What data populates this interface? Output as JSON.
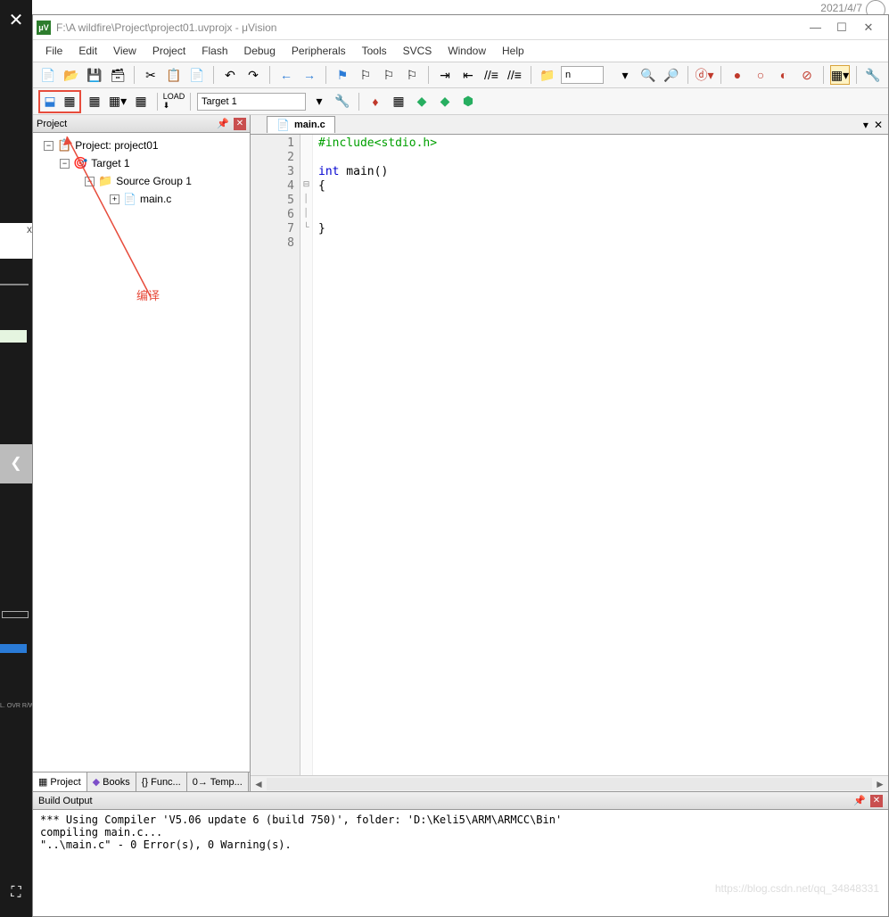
{
  "date": "2021/4/7",
  "window": {
    "title": "F:\\A wildfire\\Project\\project01.uvprojx - μVision",
    "appicon_text": "μV"
  },
  "menu": [
    "File",
    "Edit",
    "View",
    "Project",
    "Flash",
    "Debug",
    "Peripherals",
    "Tools",
    "SVCS",
    "Window",
    "Help"
  ],
  "toolbar1": {
    "search_value": "n"
  },
  "toolbar2": {
    "target": "Target 1"
  },
  "project_panel": {
    "title": "Project",
    "root": "Project: project01",
    "target": "Target 1",
    "group": "Source Group 1",
    "file": "main.c",
    "tabs": {
      "project": "Project",
      "books": "Books",
      "func": "{} Func...",
      "temp": "0→ Temp..."
    }
  },
  "annotation": "编译",
  "editor": {
    "tab": "main.c",
    "lines": [
      "1",
      "2",
      "3",
      "4",
      "5",
      "6",
      "7",
      "8"
    ],
    "code": {
      "l1_pp": "#include<stdio.h>",
      "l3_kw": "int",
      "l3_rest": " main()",
      "l4": "{",
      "l7": "}"
    }
  },
  "build": {
    "title": "Build Output",
    "line1": "*** Using Compiler 'V5.06 update 6 (build 750)', folder: 'D:\\Keli5\\ARM\\ARMCC\\Bin'",
    "line2": "compiling main.c...",
    "line3": "\"..\\main.c\" - 0 Error(s), 0 Warning(s)."
  },
  "watermark": "https://blog.csdn.net/qq_34848331"
}
